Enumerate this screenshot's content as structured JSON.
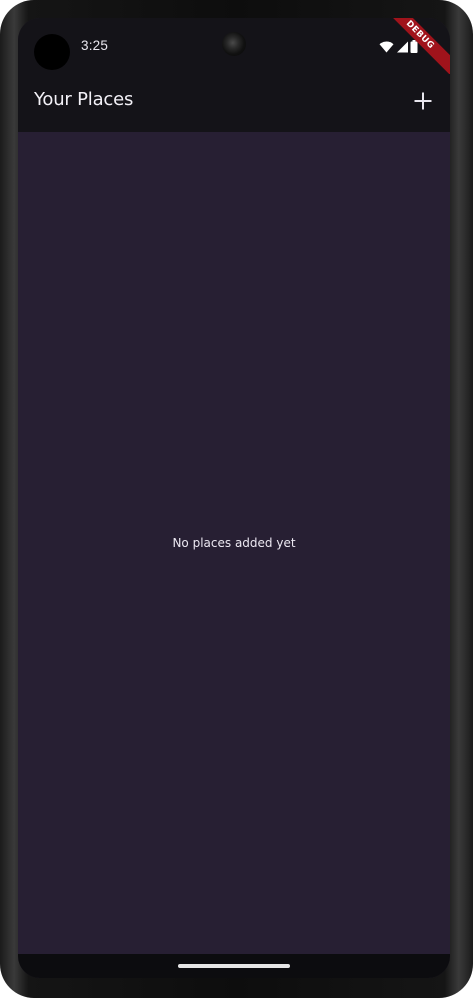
{
  "status_bar": {
    "time": "3:25",
    "icons": [
      "wifi-icon",
      "cellular-signal-icon",
      "battery-icon"
    ],
    "debug_banner": "DEBUG"
  },
  "app_bar": {
    "title": "Your Places",
    "action_icon": "plus-icon"
  },
  "content": {
    "empty_message": "No places added yet"
  },
  "colors": {
    "app_bar_background": "#141318",
    "body_background": "#271f33",
    "text": "#f3f1f7",
    "debug_banner": "#a0131b"
  }
}
